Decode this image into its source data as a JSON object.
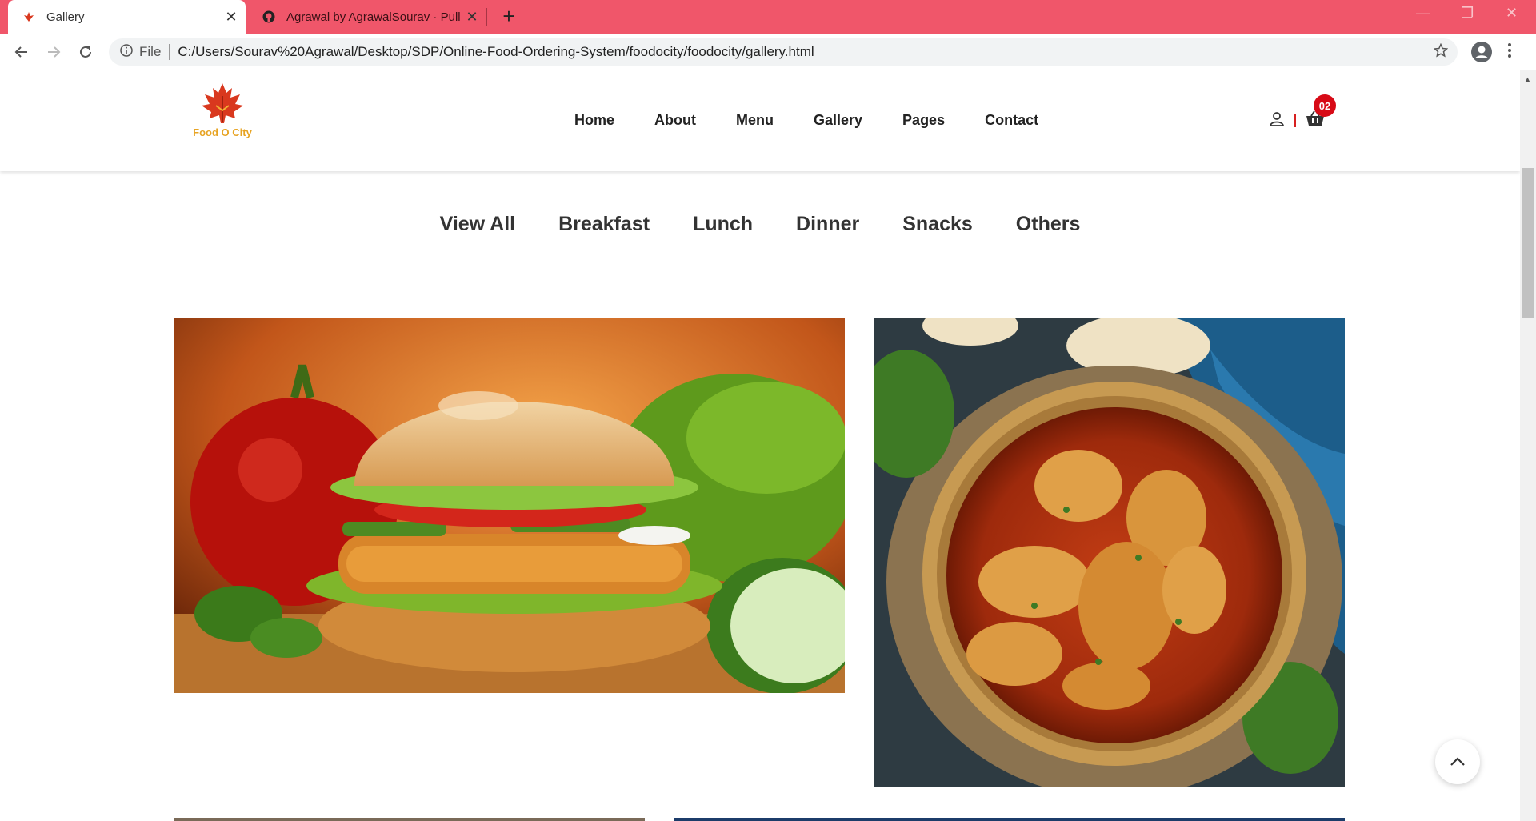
{
  "browser": {
    "tabs": [
      {
        "title": "Gallery",
        "active": true
      },
      {
        "title": "Agrawal by AgrawalSourav · Pull",
        "active": false
      }
    ],
    "omnibox": {
      "scheme_label": "File",
      "url": "C:/Users/Sourav%20Agrawal/Desktop/SDP/Online-Food-Ordering-System/foodocity/foodocity/gallery.html"
    }
  },
  "site": {
    "logo_text": "Food O City",
    "nav": [
      "Home",
      "About",
      "Menu",
      "Gallery",
      "Pages",
      "Contact"
    ],
    "cart_count": "02"
  },
  "filters": [
    "View All",
    "Breakfast",
    "Lunch",
    "Dinner",
    "Snacks",
    "Others"
  ],
  "colors": {
    "tab_bar": "#f0566a",
    "badge": "#d70a16",
    "logo_text": "#e7a424"
  },
  "gallery": [
    {
      "name": "burger-image",
      "subject": "burger"
    },
    {
      "name": "chicken-curry-image",
      "subject": "chicken curry"
    }
  ]
}
